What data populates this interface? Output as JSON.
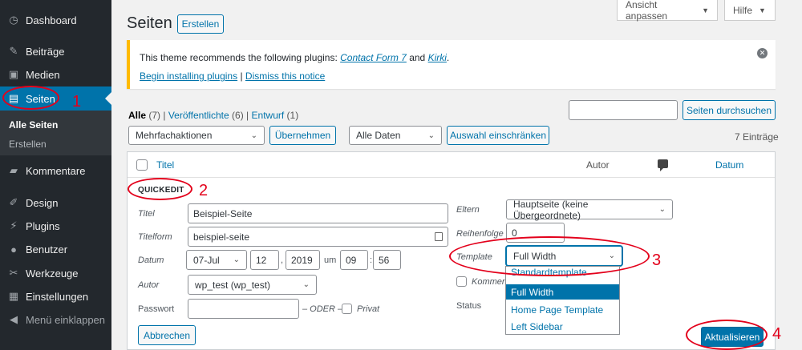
{
  "sidebar": {
    "items": [
      {
        "label": "Dashboard",
        "icon": "dashboard-icon"
      },
      {
        "label": "Beiträge",
        "icon": "pin-icon"
      },
      {
        "label": "Medien",
        "icon": "media-icon"
      },
      {
        "label": "Seiten",
        "icon": "pages-icon"
      },
      {
        "label": "Kommentare",
        "icon": "comment-icon"
      },
      {
        "label": "Design",
        "icon": "brush-icon"
      },
      {
        "label": "Plugins",
        "icon": "plugin-icon"
      },
      {
        "label": "Benutzer",
        "icon": "user-icon"
      },
      {
        "label": "Werkzeuge",
        "icon": "wrench-icon"
      },
      {
        "label": "Einstellungen",
        "icon": "settings-icon"
      },
      {
        "label": "Menü einklappen",
        "icon": "collapse-icon"
      }
    ],
    "submenu": [
      "Alle Seiten",
      "Erstellen"
    ]
  },
  "top": {
    "screen_options": "Ansicht anpassen",
    "help": "Hilfe"
  },
  "header": {
    "title": "Seiten",
    "add_new": "Erstellen"
  },
  "notice": {
    "text_before": "This theme recommends the following plugins:",
    "plugin1": "Contact Form 7",
    "and": "and",
    "plugin2": "Kirki",
    "period": ".",
    "install_link": "Begin installing plugins",
    "separator": "|",
    "dismiss_link": "Dismiss this notice"
  },
  "filters": {
    "all": "Alle",
    "all_count": "(7)",
    "sep": "|",
    "published": "Veröffentlichte",
    "published_count": "(6)",
    "draft": "Entwurf",
    "draft_count": "(1)",
    "bulk_action": "Mehrfachaktionen",
    "apply": "Übernehmen",
    "dates": "Alle Daten",
    "filter": "Auswahl einschränken",
    "search_value": "",
    "search_button": "Seiten durchsuchen",
    "count": "7 Einträge"
  },
  "table": {
    "col_title": "Titel",
    "col_author": "Autor",
    "col_date": "Datum"
  },
  "quickedit": {
    "heading": "QUICKEDIT",
    "title_label": "Titel",
    "title_value": "Beispiel-Seite",
    "slug_label": "Titelform",
    "slug_value": "beispiel-seite",
    "date_label": "Datum",
    "month": "07-Jul",
    "day": "12",
    "comma": ",",
    "year": "2019",
    "at": "um",
    "hour": "09",
    "colon": ":",
    "minute": "56",
    "author_label": "Autor",
    "author_value": "wp_test (wp_test)",
    "password_label": "Passwort",
    "password_value": "",
    "or": "– ODER –",
    "private": "Privat",
    "cancel": "Abbrechen",
    "parent_label": "Eltern",
    "parent_value": "Hauptseite (keine Übergeordnete)",
    "order_label": "Reihenfolge",
    "order_value": "0",
    "template_label": "Template",
    "template_value": "Full Width",
    "comments_label": "Komment",
    "status_label": "Status",
    "template_options": [
      "Standardtemplate",
      "Full Width",
      "Home Page Template",
      "Left Sidebar"
    ],
    "update": "Aktualisieren"
  },
  "annotations": [
    "1",
    "2",
    "3",
    "4"
  ],
  "colors": {
    "accent": "#0073aa",
    "sidebar": "#23282d",
    "annotation": "#e3001b",
    "notice": "#ffba00"
  }
}
